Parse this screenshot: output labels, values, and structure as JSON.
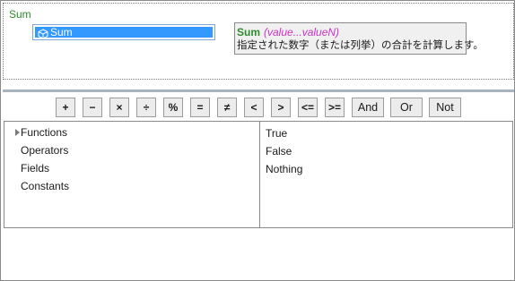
{
  "editor": {
    "expression": "Sum",
    "autocomplete_item": "Sum",
    "tooltip": {
      "name": "Sum",
      "args": "(value...valueN)",
      "description": "指定された数字（または列挙）の合計を計算します。"
    }
  },
  "toolbar": {
    "buttons": [
      "+",
      "−",
      "×",
      "÷",
      "%",
      "=",
      "≠",
      "<",
      ">",
      "<=",
      ">=",
      "And",
      "Or",
      "Not"
    ]
  },
  "categories": {
    "items": [
      "Functions",
      "Operators",
      "Fields",
      "Constants"
    ]
  },
  "values": {
    "items": [
      "True",
      "False",
      "Nothing"
    ]
  },
  "colors": {
    "expression_text": "#2e8b2e",
    "tooltip_args": "#cc33cc",
    "selection": "#3399ff"
  }
}
